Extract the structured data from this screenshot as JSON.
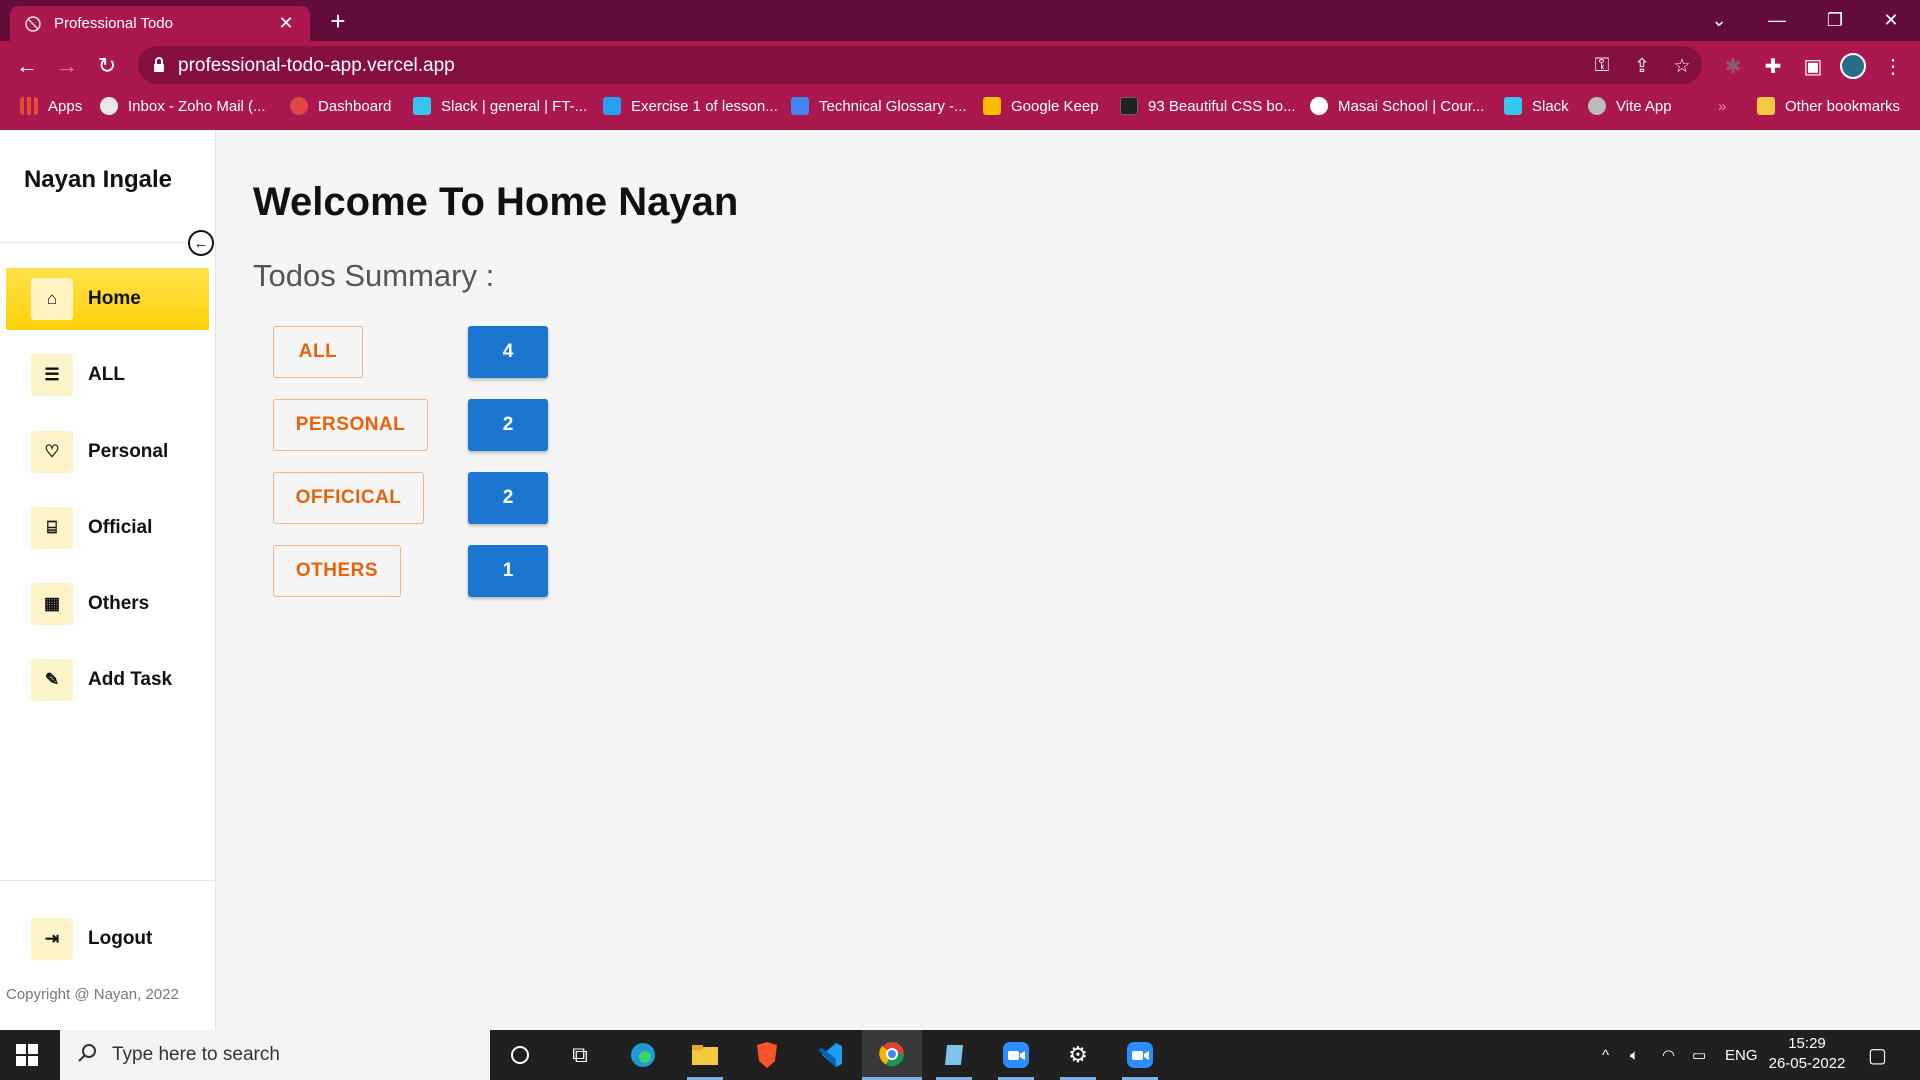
{
  "browser": {
    "tab_title": "Professional Todo",
    "tab_close": "✕",
    "new_tab": "+",
    "url": "professional-todo-app.vercel.app",
    "bookmarks": [
      {
        "label": "Apps",
        "color": "#e94b35"
      },
      {
        "label": "Inbox - Zoho Mail (...",
        "color": "#e8e8e8"
      },
      {
        "label": "Dashboard",
        "color": "#e04848"
      },
      {
        "label": "Slack | general | FT-...",
        "color": "#36c5f0"
      },
      {
        "label": "Exercise 1 of lesson...",
        "color": "#2aa0f5"
      },
      {
        "label": "Technical Glossary -...",
        "color": "#4285f4"
      },
      {
        "label": "Google Keep",
        "color": "#fbbc04"
      },
      {
        "label": "93 Beautiful CSS bo...",
        "color": "#222222"
      },
      {
        "label": "Masai School | Cour...",
        "color": "#ffffff"
      },
      {
        "label": "Slack",
        "color": "#36c5f0"
      },
      {
        "label": "Vite App",
        "color": "#bbbbbb"
      }
    ],
    "more_bookmarks": "»",
    "other_bookmarks": "Other bookmarks"
  },
  "sidebar": {
    "brand": "Nayan Ingale",
    "items": [
      {
        "label": "Home",
        "icon": "home-icon",
        "glyph": "⌂"
      },
      {
        "label": "ALL",
        "icon": "list-icon",
        "glyph": "☰"
      },
      {
        "label": "Personal",
        "icon": "heart-icon",
        "glyph": "♡"
      },
      {
        "label": "Official",
        "icon": "desk-icon",
        "glyph": "⌸"
      },
      {
        "label": "Others",
        "icon": "grid-icon",
        "glyph": "▦"
      },
      {
        "label": "Add Task",
        "icon": "pencil-icon",
        "glyph": "✎"
      }
    ],
    "logout": {
      "label": "Logout",
      "icon": "logout-icon",
      "glyph": "⇥"
    },
    "copyright": "Copyright @ Nayan, 2022"
  },
  "main": {
    "welcome": "Welcome To Home Nayan",
    "summary_title": "Todos Summary :",
    "summary": [
      {
        "category": "ALL",
        "count": "4"
      },
      {
        "category": "PERSONAL",
        "count": "2"
      },
      {
        "category": "OFFICICAL",
        "count": "2"
      },
      {
        "category": "OTHERS",
        "count": "1"
      }
    ]
  },
  "taskbar": {
    "search_placeholder": "Type here to search",
    "language": "ENG",
    "time": "15:29",
    "date": "26-05-2022"
  },
  "colors": {
    "chrome_dark": "#630c3a",
    "chrome_main": "#ab1850",
    "active_nav": "#ffd20a",
    "category_outline": "#e8620a",
    "count_button": "#1b76d2"
  }
}
